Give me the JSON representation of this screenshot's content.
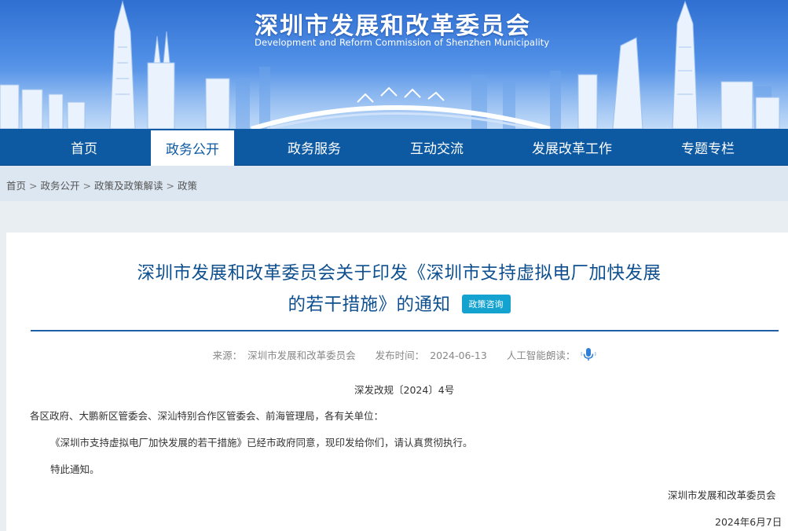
{
  "header": {
    "title": "深圳市发展和改革委员会",
    "subtitle": "Development and Reform Commission of Shenzhen Municipality"
  },
  "nav": {
    "items": [
      {
        "label": "首页"
      },
      {
        "label": "政务公开"
      },
      {
        "label": "政务服务"
      },
      {
        "label": "互动交流"
      },
      {
        "label": "发展改革工作"
      },
      {
        "label": "专题专栏"
      }
    ],
    "active": "政务公开"
  },
  "breadcrumb": {
    "items": [
      "首页",
      "政务公开",
      "政策及政策解读",
      "政策"
    ],
    "separator": ">"
  },
  "article": {
    "title_line1": "深圳市发展和改革委员会关于印发《深圳市支持虚拟电厂加快发展",
    "title_line2": "的若干措施》的通知",
    "tag": "政策咨询",
    "source_label": "来源：",
    "source": "深圳市发展和改革委员会",
    "date_label": "发布时间：",
    "date": "2024-06-13",
    "tts_label": "人工智能朗读：",
    "doc_number": "深发改规〔2024〕4号",
    "salutation": "各区政府、大鹏新区管委会、深汕特别合作区管委会、前海管理局，各有关单位：",
    "paragraph1": "《深圳市支持虚拟电厂加快发展的若干措施》已经市政府同意，现印发给你们，请认真贯彻执行。",
    "paragraph2": "特此通知。",
    "signature": "深圳市发展和改革委员会",
    "sign_date": "2024年6月7日"
  },
  "colors": {
    "nav_bg": "#0d5aa3",
    "title_color": "#0d4f8f",
    "tag_bg": "#14a3cf",
    "breadcrumb_bg": "#dde7f2"
  },
  "icons": {
    "tts": "microphone-icon"
  }
}
